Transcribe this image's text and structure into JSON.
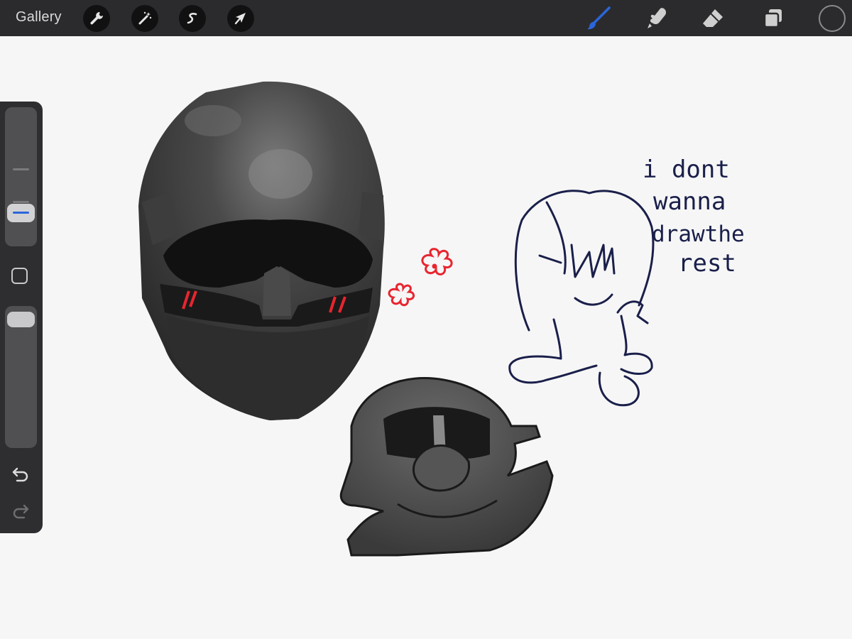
{
  "toolbar": {
    "gallery_label": "Gallery",
    "left_tools": [
      "actions-wrench",
      "adjustments-wand",
      "selection-s",
      "transform-arrow"
    ],
    "right_tools": [
      "brush",
      "smudge",
      "eraser",
      "layers"
    ],
    "active_tool": "brush",
    "active_color": "#2b2b2d",
    "accent": "#2a66d9"
  },
  "sidebar": {
    "controls": [
      "brush-size-slider",
      "modify-button",
      "opacity-slider",
      "undo",
      "redo"
    ]
  },
  "canvas": {
    "handwritten_note": [
      "i dont",
      "wanna",
      "drawthe",
      "rest"
    ],
    "ink_color": "#1a1f4a",
    "flower_color": "#e8252f"
  }
}
